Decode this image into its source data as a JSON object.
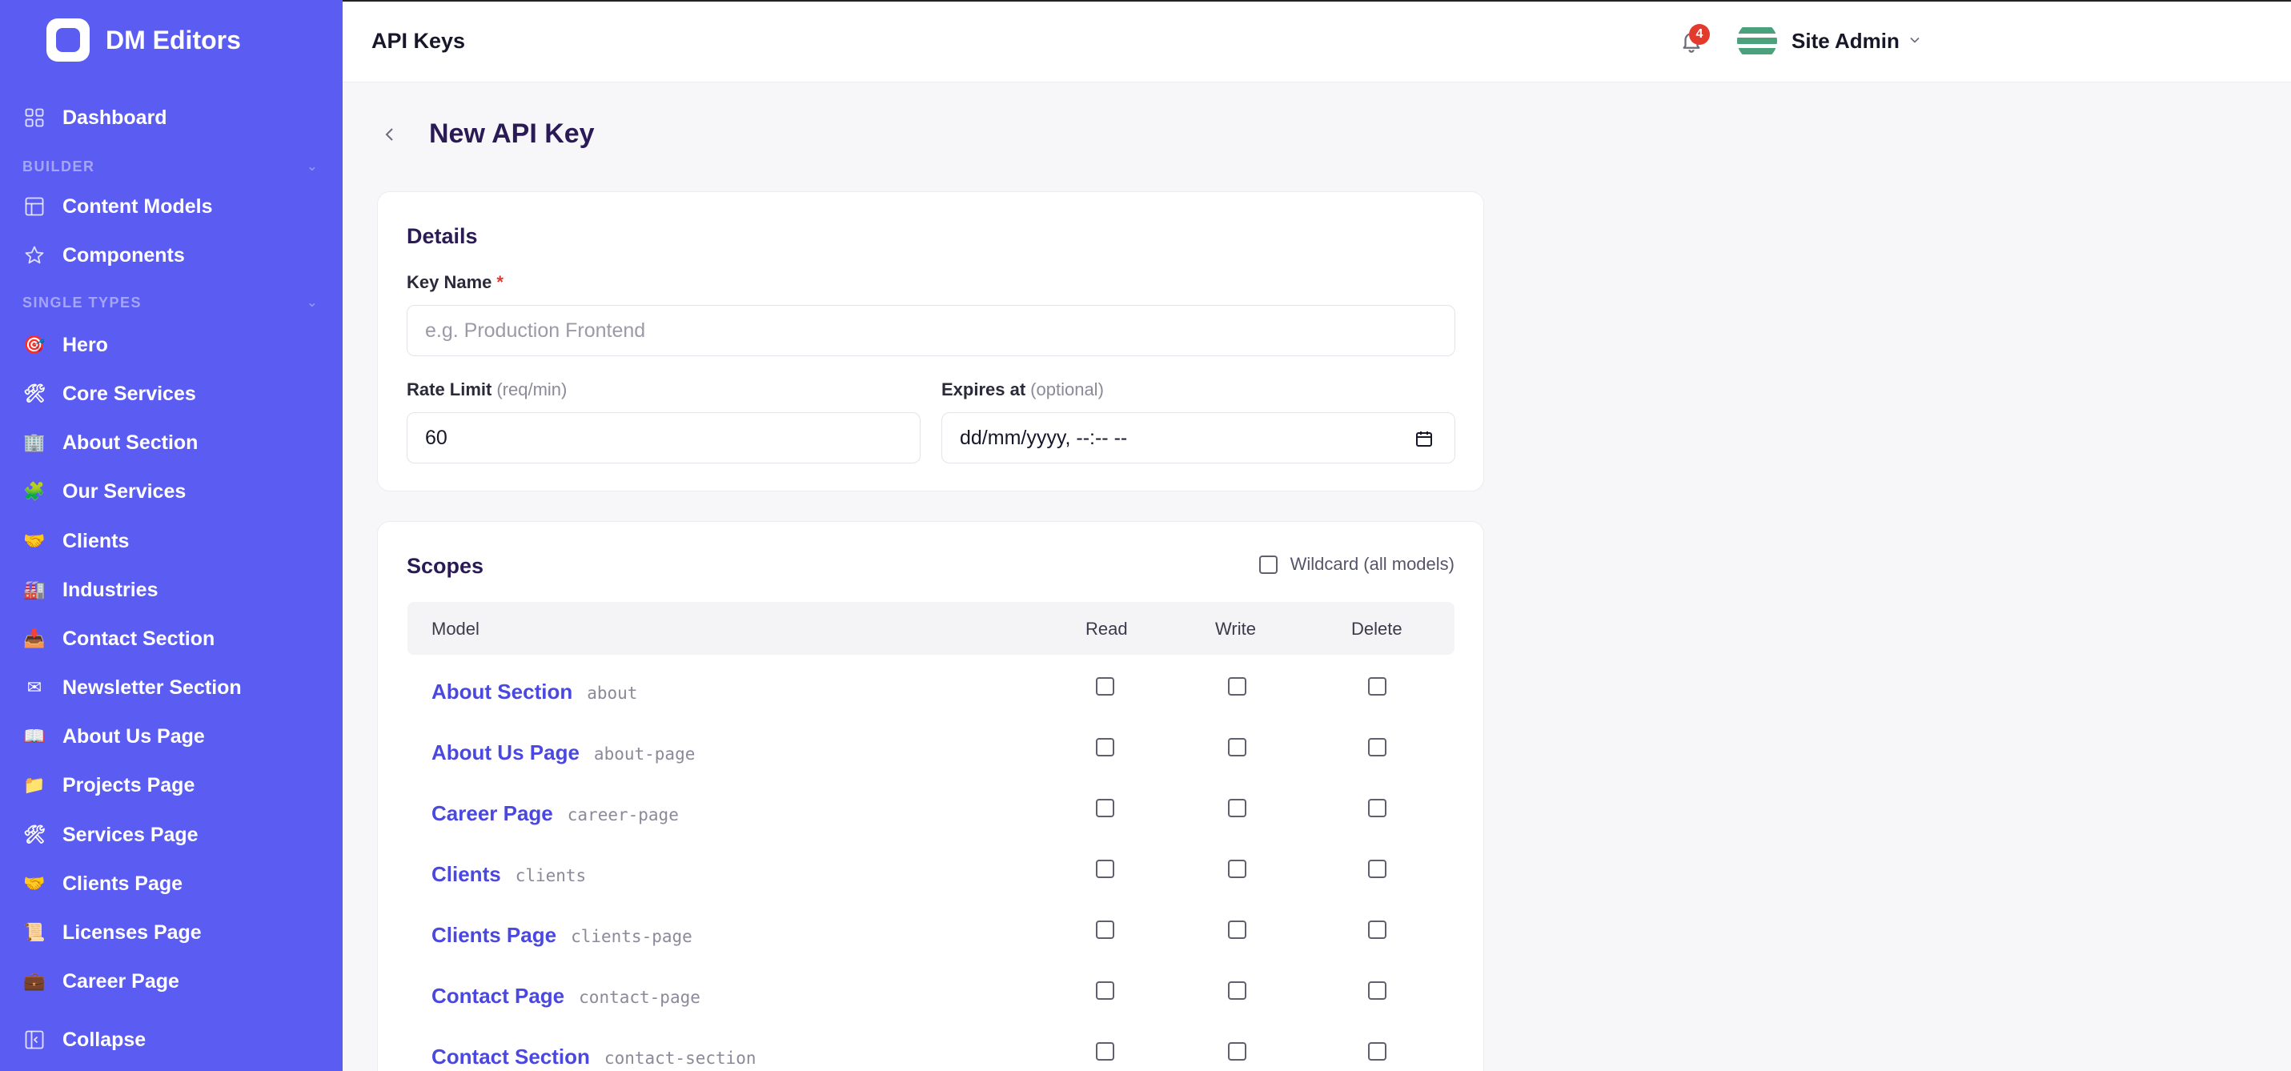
{
  "brand": {
    "name": "DM Editors"
  },
  "sidebar": {
    "dashboard": "Dashboard",
    "sections": [
      {
        "title": "BUILDER"
      },
      {
        "title": "SINGLE TYPES"
      }
    ],
    "builder_items": [
      {
        "label": "Content Models",
        "icon": "table-layout-icon"
      },
      {
        "label": "Components",
        "icon": "star-icon"
      }
    ],
    "single_types": [
      {
        "label": "Hero",
        "icon": "🎯"
      },
      {
        "label": "Core Services",
        "icon": "🛠"
      },
      {
        "label": "About Section",
        "icon": "🏢"
      },
      {
        "label": "Our Services",
        "icon": "🧩"
      },
      {
        "label": "Clients",
        "icon": "🤝"
      },
      {
        "label": "Industries",
        "icon": "🏭"
      },
      {
        "label": "Contact Section",
        "icon": "📥"
      },
      {
        "label": "Newsletter Section",
        "icon": "✉"
      },
      {
        "label": "About Us Page",
        "icon": "📖"
      },
      {
        "label": "Projects Page",
        "icon": "📁"
      },
      {
        "label": "Services Page",
        "icon": "🛠"
      },
      {
        "label": "Clients Page",
        "icon": "🤝"
      },
      {
        "label": "Licenses Page",
        "icon": "📜"
      },
      {
        "label": "Career Page",
        "icon": "💼"
      }
    ],
    "collapse": "Collapse"
  },
  "topbar": {
    "title": "API Keys",
    "notification_count": "4",
    "user_name": "Site Admin"
  },
  "page": {
    "title": "New API Key"
  },
  "details": {
    "title": "Details",
    "key_name_label": "Key Name",
    "key_name_required": "*",
    "key_name_placeholder": "e.g. Production Frontend",
    "rate_limit_label": "Rate Limit",
    "rate_limit_hint": "(req/min)",
    "rate_limit_value": "60",
    "expires_label": "Expires at",
    "expires_hint": "(optional)",
    "expires_placeholder": "dd/mm/yyyy, --:-- --"
  },
  "scopes": {
    "title": "Scopes",
    "wildcard_label": "Wildcard (all models)",
    "columns": {
      "model": "Model",
      "read": "Read",
      "write": "Write",
      "delete": "Delete"
    },
    "rows": [
      {
        "name": "About Section",
        "code": "about"
      },
      {
        "name": "About Us Page",
        "code": "about-page"
      },
      {
        "name": "Career Page",
        "code": "career-page"
      },
      {
        "name": "Clients",
        "code": "clients"
      },
      {
        "name": "Clients Page",
        "code": "clients-page"
      },
      {
        "name": "Contact Page",
        "code": "contact-page"
      },
      {
        "name": "Contact Section",
        "code": "contact-section"
      }
    ]
  },
  "colors": {
    "sidebar_bg": "#5b5cf2",
    "link": "#4a48e0",
    "badge": "#e23a2d",
    "title": "#2a1a56"
  }
}
